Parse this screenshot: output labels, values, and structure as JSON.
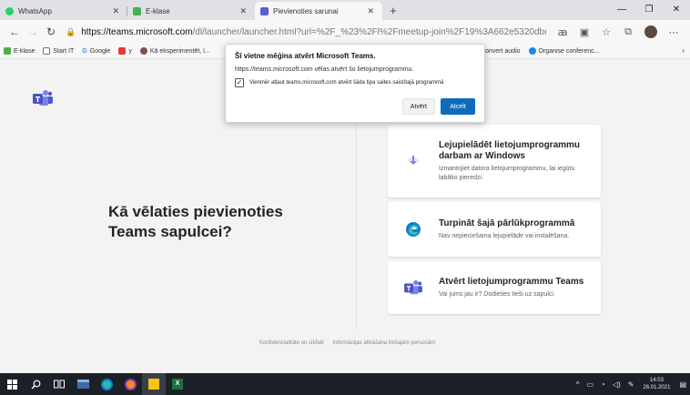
{
  "browser": {
    "tabs": [
      {
        "title": "WhatsApp",
        "close": "✕",
        "color": "#25d366",
        "active": false
      },
      {
        "title": "E-klase",
        "close": "✕",
        "color": "#4caf50",
        "active": false
      },
      {
        "title": "Pievienoties sarunai",
        "close": "✕",
        "color": "#5b5fc7",
        "active": true
      }
    ],
    "new_tab": "+",
    "window_controls": {
      "minimize": "—",
      "maximize": "❐",
      "close": "✕"
    },
    "url": {
      "host": "https://teams.microsoft.com",
      "path": "/dl/launcher/launcher.html?url=%2F_%23%2Fl%2Fmeetup-join%2F19%3A662e5320dbd04a29b..."
    },
    "bookmarks_left": [
      {
        "label": "E-klase",
        "color": "#4caf50"
      },
      {
        "label": "Start IT",
        "color": "#9e9e9e"
      },
      {
        "label": "Google",
        "color": "#4285f4"
      },
      {
        "label": "y",
        "color": "#e53935"
      },
      {
        "label": "Kā eksperimentēt, l...",
        "color": "#795548"
      }
    ],
    "bookmarks_right": [
      {
        "label": "onvert audio",
        "color": "#9e9e9e"
      },
      {
        "label": "Organise conferenc...",
        "color": "#1e88e5"
      }
    ]
  },
  "dialog": {
    "title": "Šī vietne mēģina atvērt Microsoft Teams.",
    "description": "https://teams.microsoft.com vēlas atvērt šo lietojumprogrammu.",
    "checkbox_label": "Vienmēr atļaut teams.microsoft.com atvērt šāda tipa saites saistītajā programmā",
    "checkbox_checked": true,
    "open_label": "Atvērt",
    "cancel_label": "Atcelt"
  },
  "page": {
    "question": "Kā vēlaties pievienoties Teams sapulcei?",
    "options": [
      {
        "title": "Lejupielādēt lietojumprogrammu darbam ar Windows",
        "subtitle": "Izmantojiet datora lietojumprogrammu, lai iegūtu labāko pieredzi."
      },
      {
        "title": "Turpināt šajā pārlūkprogrammā",
        "subtitle": "Nav nepieciešama lejupielāde vai instalēšana."
      },
      {
        "title": "Atvērt lietojumprogrammu Teams",
        "subtitle": "Vai jums jau ir? Dodieties tieši uz sapulci."
      }
    ],
    "footer_links": [
      "Konfidencialitāte un sīkfaili",
      "Informācijas atklāšana trešajām personām"
    ]
  },
  "taskbar": {
    "time": "14:03",
    "date": "26.01.2021"
  },
  "colors": {
    "teams": "#5b5fc7",
    "primary": "#0f6cbd"
  }
}
